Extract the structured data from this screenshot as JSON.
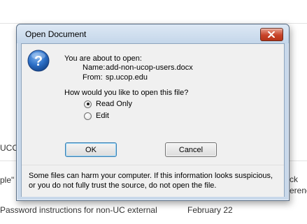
{
  "background": {
    "partial_text_1": "UCOP",
    "partial_text_2": "ple\"",
    "partial_text_3": "ck",
    "partial_text_4": "erenc",
    "row_title": "Password instructions for non-UC external",
    "row_date": "February 22"
  },
  "dialog": {
    "title": "Open Document",
    "intro": "You are about to open:",
    "name_label": "Name:",
    "name_value": "add-non-ucop-users.docx",
    "from_label": "From:",
    "from_value": "sp.ucop.edu",
    "question": "How would you like to open this file?",
    "options": [
      {
        "label": "Read Only",
        "checked": true
      },
      {
        "label": "Edit",
        "checked": false
      }
    ],
    "ok_label": "OK",
    "cancel_label": "Cancel",
    "warning": "Some files can harm your computer. If this information looks suspicious, or you do not fully trust the source, do not open the file."
  },
  "colors": {
    "title_bar": "#c4d6ea",
    "close_button": "#c8442a",
    "client_bg": "#f0f0f0"
  },
  "icons": {
    "dialog_icon": "question-icon",
    "close": "close-icon"
  }
}
